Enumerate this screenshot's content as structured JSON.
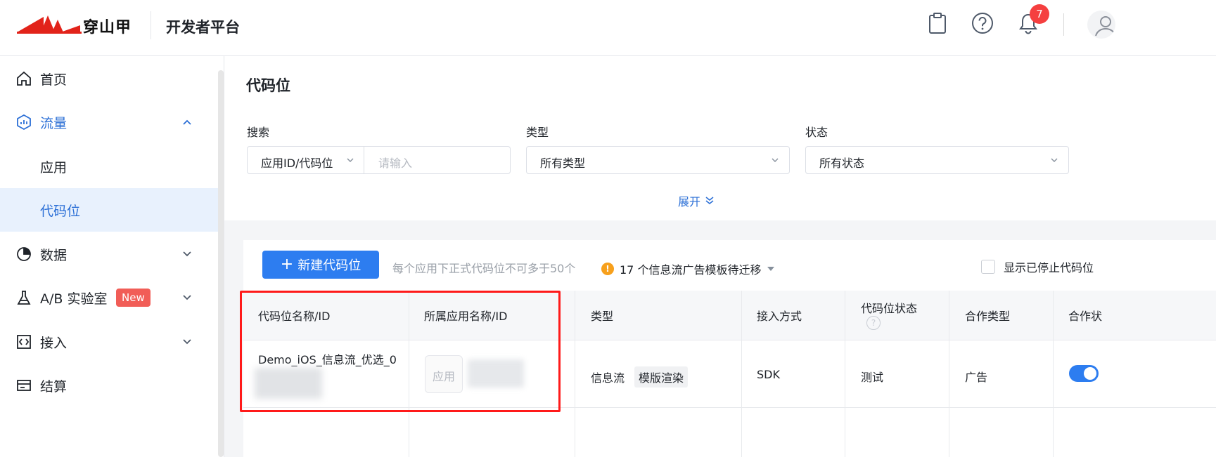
{
  "header": {
    "brand": "穿山甲",
    "platform": "开发者平台",
    "notification_count": "7",
    "icons": [
      "clipboard-icon",
      "help-icon",
      "bell-icon",
      "user-icon"
    ]
  },
  "sidebar": {
    "items": [
      {
        "label": "首页",
        "icon": "home-icon"
      },
      {
        "label": "流量",
        "icon": "traffic-icon",
        "expanded": true
      },
      {
        "label": "应用"
      },
      {
        "label": "代码位",
        "active": true
      },
      {
        "label": "数据",
        "icon": "pie-chart-icon"
      },
      {
        "label": "A/B 实验室",
        "icon": "flask-icon",
        "badge": "New"
      },
      {
        "label": "接入",
        "icon": "integration-icon"
      },
      {
        "label": "结算",
        "icon": "billing-icon"
      }
    ]
  },
  "page": {
    "title": "代码位",
    "filters": {
      "search_label": "搜索",
      "search_type": "应用ID/代码位",
      "search_placeholder": "请输入",
      "type_label": "类型",
      "type_value": "所有类型",
      "status_label": "状态",
      "status_value": "所有状态",
      "expand_label": "展开"
    },
    "toolbar": {
      "new_button": "新建代码位",
      "hint": "每个应用下正式代码位不可多于50个",
      "warning": "17 个信息流广告模板待迁移",
      "show_stopped": "显示已停止代码位"
    },
    "table": {
      "columns": [
        "代码位名称/ID",
        "所属应用名称/ID",
        "类型",
        "接入方式",
        "代码位状态",
        "合作类型",
        "合作状"
      ],
      "rows": [
        {
          "name": "Demo_iOS_信息流_优选_0",
          "app_placeholder": "应用",
          "type": "信息流",
          "type_tag": "模版渲染",
          "access": "SDK",
          "status": "测试",
          "coop_type": "广告",
          "coop_status_on": true
        }
      ]
    }
  },
  "colors": {
    "accent": "#2d7df0",
    "highlight": "#ff1a1a",
    "badge": "#f53f3f",
    "warning": "#f7a01c"
  }
}
